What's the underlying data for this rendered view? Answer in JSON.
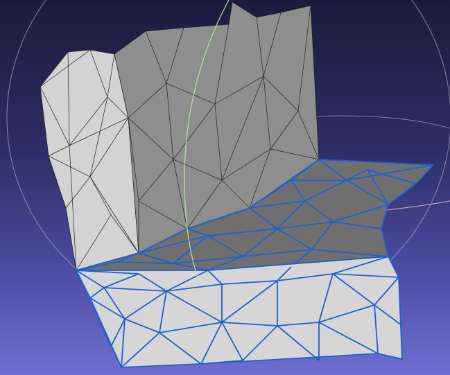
{
  "viewport": {
    "background_top": "#1c1a3c",
    "background_bottom": "#6f6fd2"
  },
  "mesh": {
    "unselected_fill_light": "#d3d3d3",
    "unselected_fill_dark": "#8e8e8e",
    "wire_color": "#222222",
    "selected_wire_color": "#1f5fd0",
    "selected_fill_top": "#6f6f6f",
    "selected_fill_front": "#d6d6d6"
  },
  "trackball": {
    "ring_vertical_color": "#b8e8a8",
    "ring_horizontal_color": "#d8b0c8",
    "ring_outer_color": "#b0b0c8"
  }
}
